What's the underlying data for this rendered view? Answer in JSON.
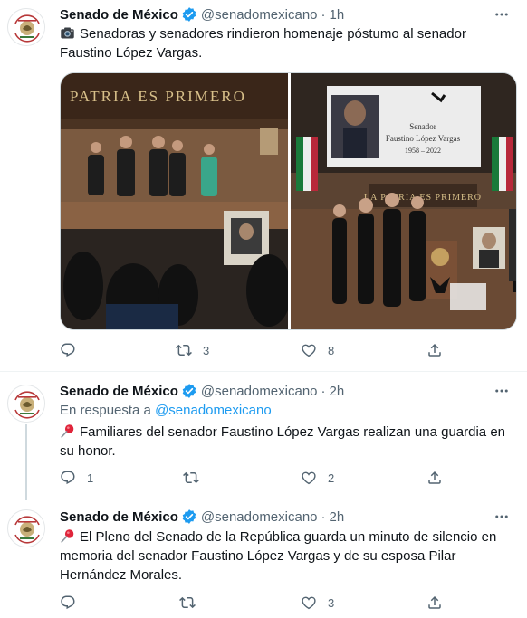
{
  "tweets": [
    {
      "author": "Senado de México",
      "handle": "@senadomexicano",
      "time": "1h",
      "text": "Senadoras y senadores rindieron homenaje póstumo al senador Faustino López Vargas.",
      "media": {
        "left_wall_text": "PATRIA ES PRIMERO",
        "screen_label": "Senador",
        "screen_name": "Faustino López Vargas",
        "screen_years": "1958 – 2022",
        "right_wall_text": "LA PATRIA ES PRIMERO"
      },
      "counts": {
        "replies": "",
        "retweets": "3",
        "likes": "8"
      }
    },
    {
      "author": "Senado de México",
      "handle": "@senadomexicano",
      "time": "2h",
      "reply_prefix": "En respuesta a",
      "reply_handle": "@senadomexicano",
      "text": "Familiares del senador Faustino López Vargas realizan una guardia en su honor.",
      "counts": {
        "replies": "1",
        "retweets": "",
        "likes": "2"
      }
    },
    {
      "author": "Senado de México",
      "handle": "@senadomexicano",
      "time": "2h",
      "text": "El Pleno del Senado de la República guarda un minuto de silencio en memoria del senador Faustino López Vargas y de su esposa Pilar Hernández Morales.",
      "counts": {
        "replies": "",
        "retweets": "",
        "likes": "3"
      }
    }
  ],
  "separator": "·",
  "colors": {
    "text": "#0f1419",
    "secondary": "#536471",
    "link": "#1d9bf0",
    "verified": "#1d9bf0",
    "divider": "#eff3f4",
    "thread_line": "#cfd9de"
  },
  "icons": [
    "senado-logo-icon",
    "verified-badge-icon",
    "more-icon",
    "camera-emoji-icon",
    "pushpin-emoji-icon",
    "reply-icon",
    "retweet-icon",
    "like-icon",
    "share-icon"
  ]
}
